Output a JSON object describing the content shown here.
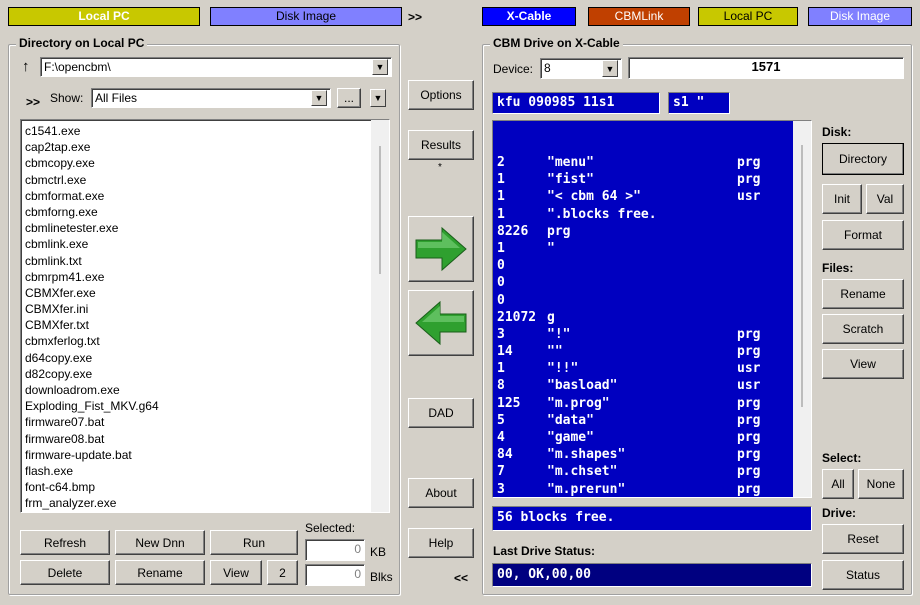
{
  "top_modes": {
    "left_local": "Local PC",
    "left_disk": "Disk Image",
    "swap_arrow": ">>",
    "xcable": "X-Cable",
    "cbmlink": "CBMLink",
    "right_local": "Local PC",
    "right_disk": "Disk Image"
  },
  "colors": {
    "local_pc": "#c8c800",
    "disk_image": "#8080ff",
    "xcable": "#0000ff",
    "cbmlink": "#c04000",
    "cbm_blue": "#0000c0",
    "status_blue": "#000080"
  },
  "local": {
    "group_title": "Directory on Local PC",
    "up_icon": "up-arrow-icon",
    "path": "F:\\opencbm\\",
    "expand_arrow": ">>",
    "show_label": "Show:",
    "show_value": "All Files",
    "browse_label": "...",
    "files": [
      "c1541.exe",
      "cap2tap.exe",
      "cbmcopy.exe",
      "cbmctrl.exe",
      "cbmformat.exe",
      "cbmforng.exe",
      "cbmlinetester.exe",
      "cbmlink.exe",
      "cbmlink.txt",
      "cbmrpm41.exe",
      "CBMXfer.exe",
      "CBMXfer.ini",
      "CBMXfer.txt",
      "cbmxferlog.txt",
      "d64copy.exe",
      "d82copy.exe",
      "downloadrom.exe",
      "Exploding_Fist_MKV.g64",
      "firmware07.bat",
      "firmware08.bat",
      "firmware-update.bat",
      "flash.exe",
      "font-c64.bmp",
      "frm_analyzer.exe"
    ],
    "buttons": {
      "refresh": "Refresh",
      "new_dir": "New Dnn",
      "run": "Run",
      "delete": "Delete",
      "rename": "Rename",
      "view": "View",
      "two": "2"
    },
    "selected_label": "Selected:",
    "selected_kb": "0",
    "kb_unit": "KB",
    "selected_blks": "0",
    "blks_unit": "Blks"
  },
  "middle": {
    "options": "Options",
    "results": "Results",
    "results_star": "*",
    "copy_right_icon": "arrow-right-icon",
    "copy_left_icon": "arrow-left-icon",
    "dad": "DAD",
    "about": "About",
    "help": "Help",
    "collapse_arrow": "<<"
  },
  "cbm": {
    "group_title": "CBM Drive on X-Cable",
    "device_label": "Device:",
    "device_value": "8",
    "drive_model": "1571",
    "disk_name": "kfu 090985 11s1",
    "disk_id": "s1 \"",
    "entries": [
      {
        "blocks": "2",
        "name": "\"menu\"",
        "type": "prg"
      },
      {
        "blocks": "1",
        "name": "\"fist\"",
        "type": "prg"
      },
      {
        "blocks": "1",
        "name": "\"< cbm 64 >\"",
        "type": "usr"
      },
      {
        "blocks": "1",
        "name": "\".blocks free.",
        "type": ""
      },
      {
        "blocks": "8226",
        "name": "prg",
        "type": ""
      },
      {
        "blocks": "1",
        "name": "\"",
        "type": ""
      },
      {
        "blocks": "0",
        "name": "",
        "type": ""
      },
      {
        "blocks": "0",
        "name": "",
        "type": ""
      },
      {
        "blocks": "0",
        "name": "",
        "type": ""
      },
      {
        "blocks": "21072",
        "name": "g",
        "type": ""
      },
      {
        "blocks": "3",
        "name": "\"!\"",
        "type": "prg"
      },
      {
        "blocks": "14",
        "name": "\"\"",
        "type": "prg"
      },
      {
        "blocks": "1",
        "name": "\"!!\"",
        "type": "usr"
      },
      {
        "blocks": "8",
        "name": "\"basload\"",
        "type": "usr"
      },
      {
        "blocks": "125",
        "name": "\"m.prog\"",
        "type": "prg"
      },
      {
        "blocks": "5",
        "name": "\"data\"",
        "type": "prg"
      },
      {
        "blocks": "4",
        "name": "\"game\"",
        "type": "prg"
      },
      {
        "blocks": "84",
        "name": "\"m.shapes\"",
        "type": "prg"
      },
      {
        "blocks": "7",
        "name": "\"m.chset\"",
        "type": "prg"
      },
      {
        "blocks": "3",
        "name": "\"m.prerun\"",
        "type": "prg"
      }
    ],
    "blocks_free": "56 blocks free.",
    "last_status_label": "Last Drive Status:",
    "last_status": "00, OK,00,00"
  },
  "side": {
    "disk_label": "Disk:",
    "directory": "Directory",
    "init": "Init",
    "val": "Val",
    "format": "Format",
    "files_label": "Files:",
    "rename": "Rename",
    "scratch": "Scratch",
    "view": "View",
    "select_label": "Select:",
    "all": "All",
    "none": "None",
    "drive_label": "Drive:",
    "reset": "Reset",
    "status": "Status"
  }
}
